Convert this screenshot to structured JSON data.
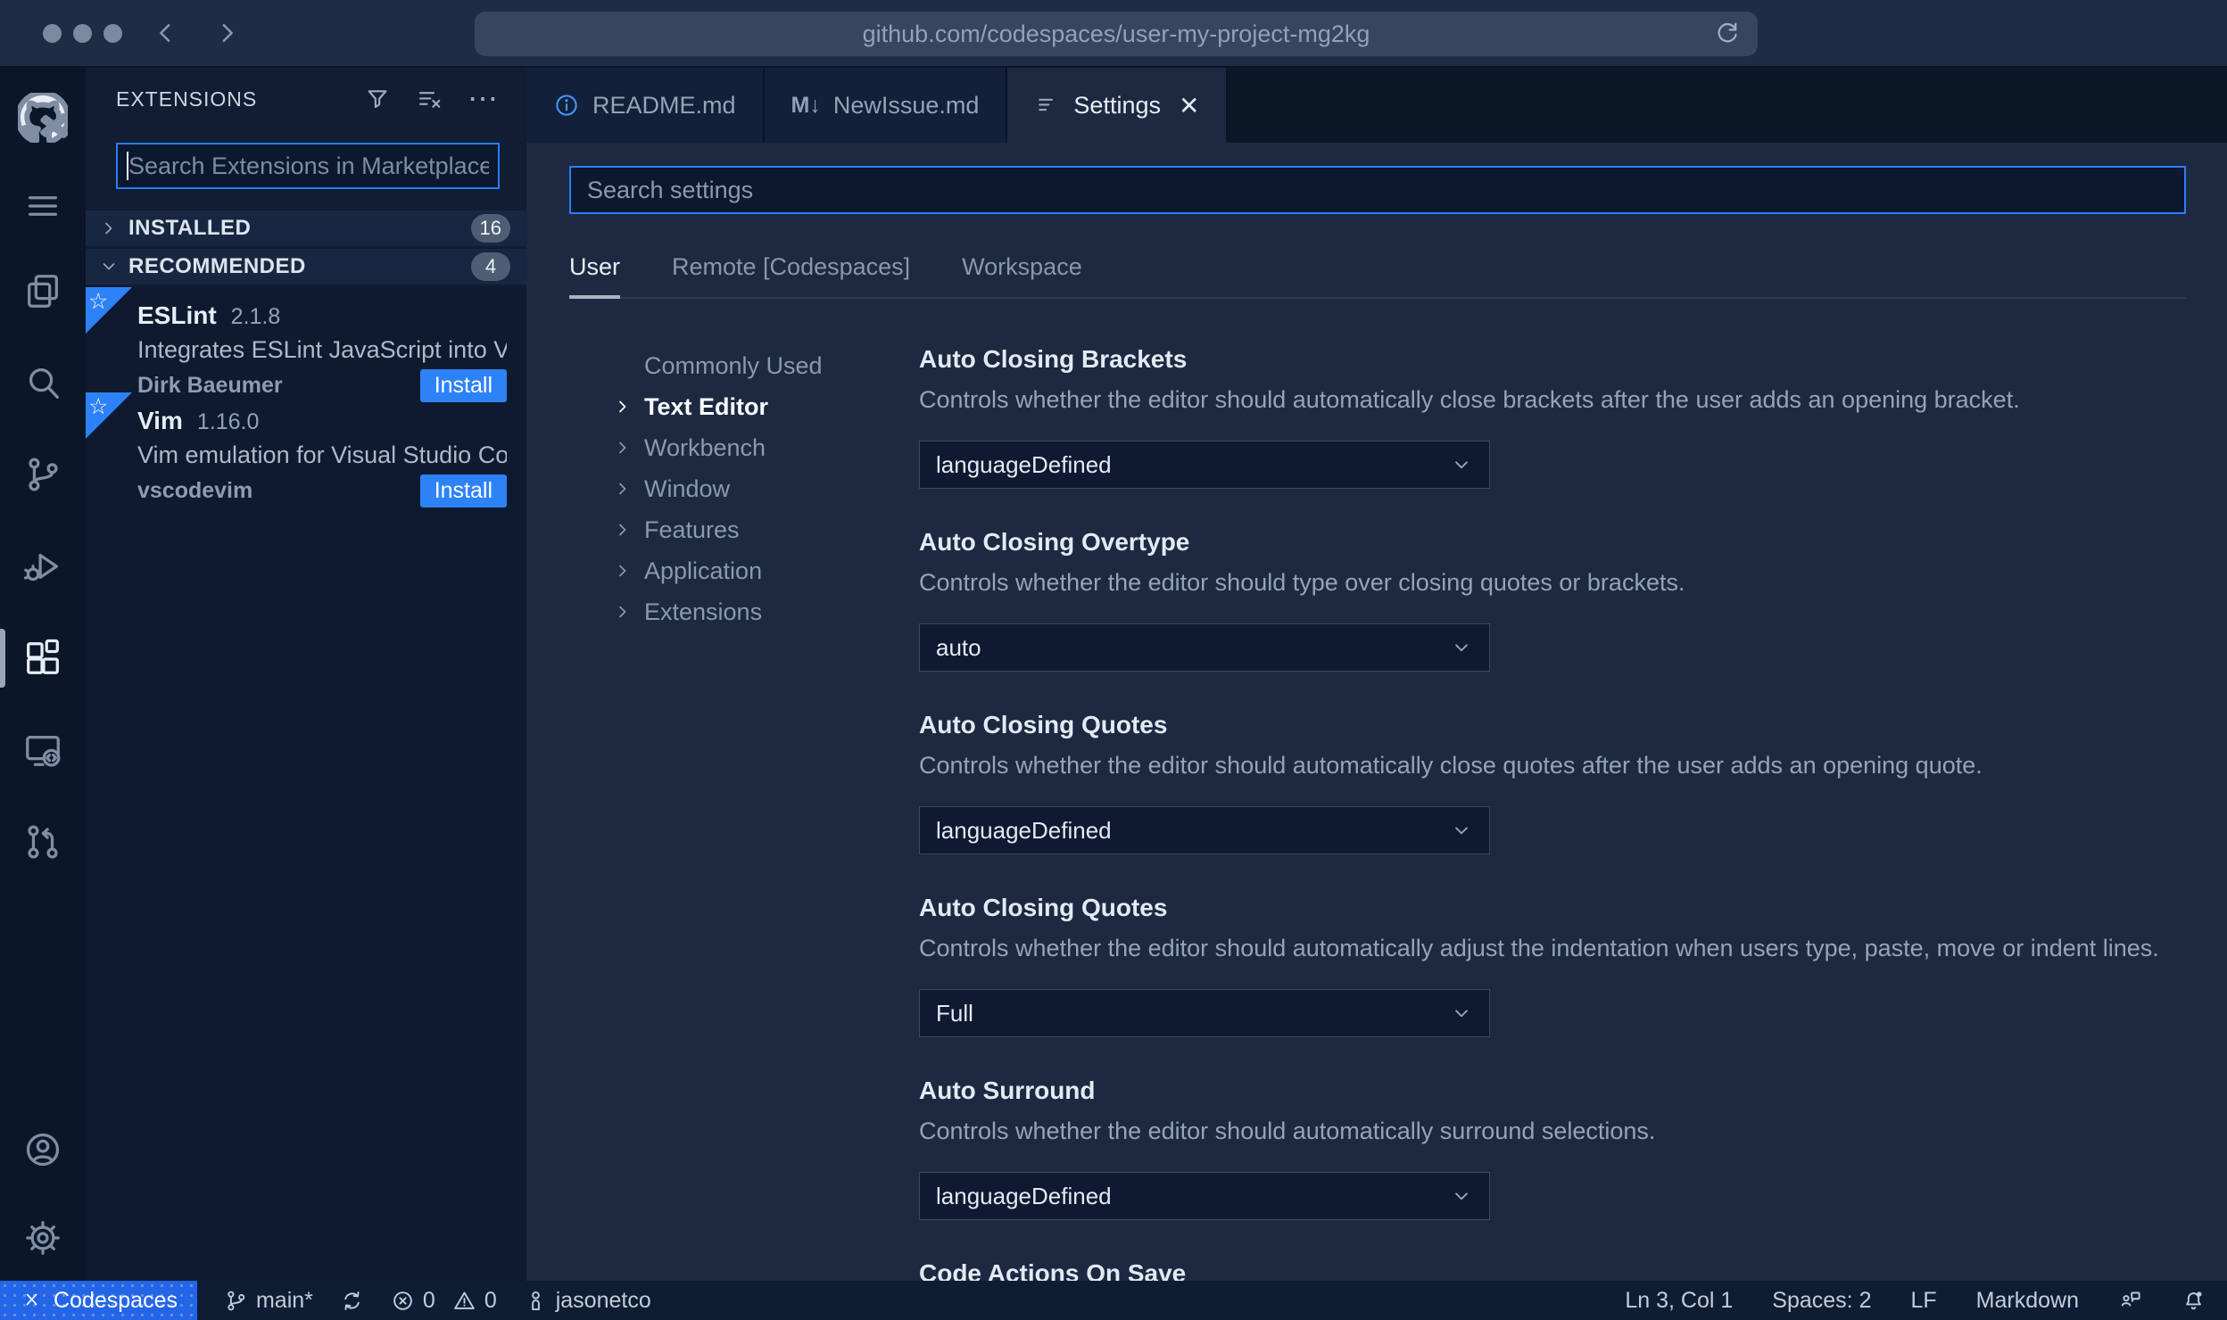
{
  "browser": {
    "url": "github.com/codespaces/user-my-project-mg2kg"
  },
  "icons": {
    "ellipsis": "⋯",
    "close": "✕",
    "markdown_tab": "M↓",
    "star": "☆"
  },
  "extensions_panel": {
    "title": "EXTENSIONS",
    "search_placeholder": "Search Extensions in Marketplace",
    "sections": [
      {
        "label": "INSTALLED",
        "count": "16"
      },
      {
        "label": "RECOMMENDED",
        "count": "4"
      }
    ],
    "items": [
      {
        "name": "ESLint",
        "version": "2.1.8",
        "description": "Integrates ESLint JavaScript into VS C...",
        "publisher": "Dirk Baeumer",
        "action": "Install"
      },
      {
        "name": "Vim",
        "version": "1.16.0",
        "description": "Vim emulation for Visual Studio Code...",
        "publisher": "vscodevim",
        "action": "Install"
      }
    ]
  },
  "tabs": [
    {
      "label": "README.md"
    },
    {
      "label": "NewIssue.md"
    },
    {
      "label": "Settings"
    }
  ],
  "settings_editor": {
    "search_placeholder": "Search settings",
    "scopes": [
      "User",
      "Remote [Codespaces]",
      "Workspace"
    ],
    "toc": [
      "Commonly Used",
      "Text Editor",
      "Workbench",
      "Window",
      "Features",
      "Application",
      "Extensions"
    ],
    "items": [
      {
        "title": "Auto Closing Brackets",
        "description": "Controls whether the editor should automatically close brackets after the user adds an opening bracket.",
        "value": "languageDefined"
      },
      {
        "title": "Auto Closing Overtype",
        "description": "Controls whether the editor should type over closing quotes or brackets.",
        "value": "auto"
      },
      {
        "title": "Auto Closing Quotes",
        "description": "Controls whether the editor should automatically close quotes after the user adds an opening quote.",
        "value": "languageDefined"
      },
      {
        "title": "Auto Closing Quotes",
        "description": "Controls whether the editor should automatically adjust the indentation when users type, paste, move or indent lines.",
        "value": "Full"
      },
      {
        "title": "Auto Surround",
        "description": "Controls whether the editor should automatically surround selections.",
        "value": "languageDefined"
      },
      {
        "title": "Code Actions On Save"
      }
    ]
  },
  "status_bar": {
    "codespaces": "Codespaces",
    "branch": "main*",
    "errors": "0",
    "warnings": "0",
    "user": "jasonetco",
    "line_col": "Ln 3, Col 1",
    "indentation": "Spaces: 2",
    "eol": "LF",
    "language": "Markdown"
  },
  "colors": {
    "accent_blue": "#2e82f8",
    "focus_border": "#2b7cf8",
    "codespaces_badge": "#2365e9",
    "info_icon": "#4493f8"
  }
}
